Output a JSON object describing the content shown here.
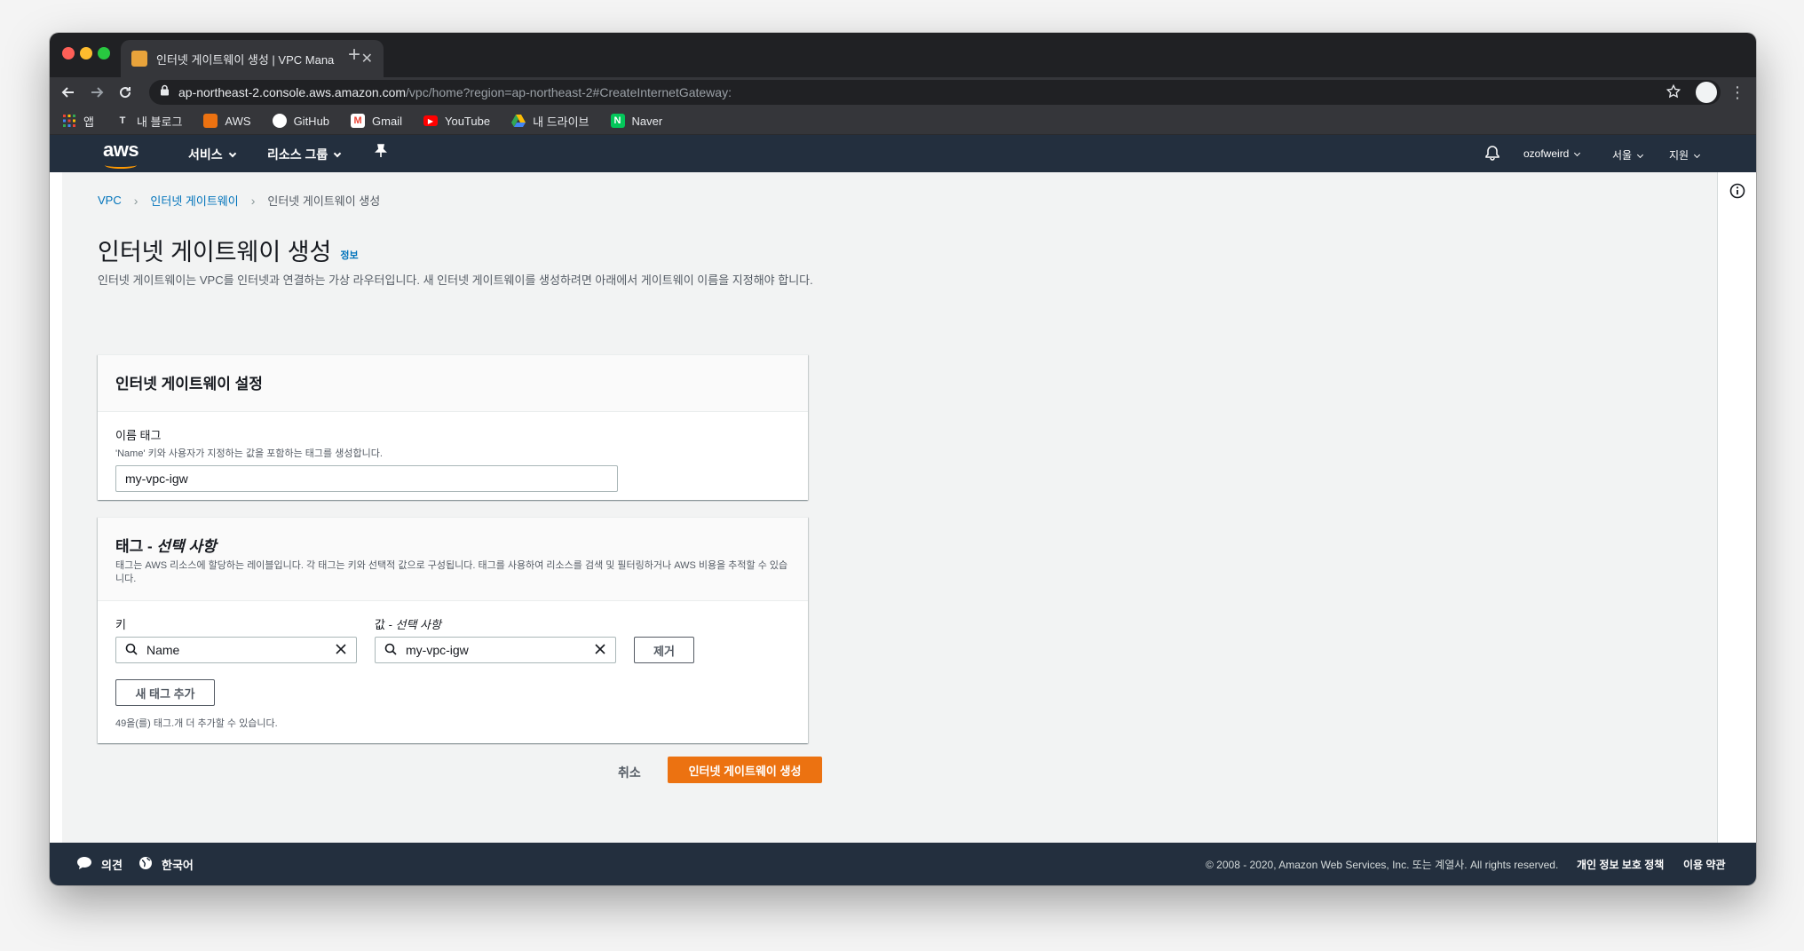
{
  "browser": {
    "tab_title": "인터넷 게이트웨이 생성 | VPC Mana",
    "url_host": "ap-northeast-2.console.aws.amazon.com",
    "url_path": "/vpc/home?region=ap-northeast-2#CreateInternetGateway:",
    "bookmarks": [
      {
        "label": "앱",
        "icon": "apps-grid-icon",
        "color": "#ea4335"
      },
      {
        "label": "내 블로그",
        "icon": "tistory-icon",
        "color": "#5f6368"
      },
      {
        "label": "AWS",
        "icon": "aws-cube-icon",
        "color": "#ec7211"
      },
      {
        "label": "GitHub",
        "icon": "github-icon",
        "color": "#ffffff"
      },
      {
        "label": "Gmail",
        "icon": "gmail-icon",
        "color": "#ea4335"
      },
      {
        "label": "YouTube",
        "icon": "youtube-icon",
        "color": "#ff0000"
      },
      {
        "label": "내 드라이브",
        "icon": "drive-icon",
        "color": "#34a853"
      },
      {
        "label": "Naver",
        "icon": "naver-icon",
        "color": "#03c75a"
      }
    ]
  },
  "awsnav": {
    "logo": "aws",
    "services": "서비스",
    "resource_groups": "리소스 그룹",
    "user": "ozofweird",
    "region": "서울",
    "support": "지원"
  },
  "breadcrumb": {
    "vpc": "VPC",
    "igw": "인터넷 게이트웨이",
    "current": "인터넷 게이트웨이 생성"
  },
  "page": {
    "title": "인터넷 게이트웨이 생성",
    "info": "정보",
    "description": "인터넷 게이트웨이는 VPC를 인터넷과 연결하는 가상 라우터입니다. 새 인터넷 게이트웨이를 생성하려면 아래에서 게이트웨이 이름을 지정해야 합니다."
  },
  "settings": {
    "title": "인터넷 게이트웨이 설정",
    "name_label": "이름 태그",
    "name_hint": "'Name' 키와 사용자가 지정하는 값을 포함하는 태그를 생성합니다.",
    "name_value": "my-vpc-igw"
  },
  "tags": {
    "title_prefix": "태그 - ",
    "title_optional": "선택 사항",
    "description": "태그는 AWS 리소스에 할당하는 레이블입니다. 각 태그는 키와 선택적 값으로 구성됩니다. 태그를 사용하여 리소스를 검색 및 필터링하거나 AWS 비용을 추적할 수 있습니다.",
    "key_label": "키",
    "value_label_prefix": "값 - ",
    "value_label_optional": "선택 사항",
    "key_value": "Name",
    "value_value": "my-vpc-igw",
    "remove": "제거",
    "add": "새 태그 추가",
    "remaining": "49을(를) 태그.개 더 추가할 수 있습니다."
  },
  "actions": {
    "cancel": "취소",
    "submit": "인터넷 게이트웨이 생성"
  },
  "footer": {
    "feedback": "의견",
    "language": "한국어",
    "copyright": "© 2008 - 2020, Amazon Web Services, Inc. 또는 계열사. All rights reserved.",
    "privacy": "개인 정보 보호 정책",
    "terms": "이용 약관"
  },
  "colors": {
    "primary": "#ec7211",
    "link": "#0073bb",
    "nav": "#232f3e"
  }
}
